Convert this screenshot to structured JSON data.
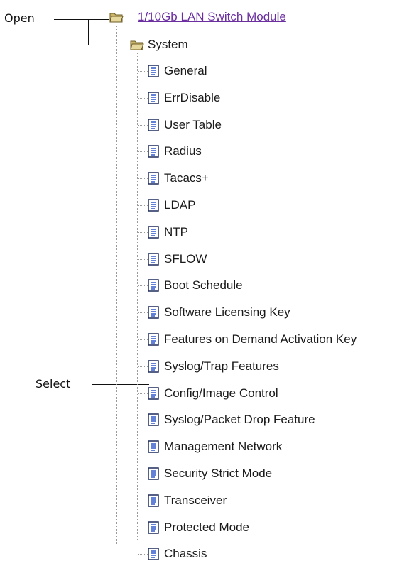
{
  "callouts": {
    "open": "Open",
    "select": "Select"
  },
  "tree": {
    "root": {
      "label": "1/10Gb LAN Switch Module",
      "icon": "folder-open-icon"
    },
    "system": {
      "label": "System",
      "icon": "folder-open-icon"
    },
    "items": [
      {
        "label": "General",
        "icon": "document-icon"
      },
      {
        "label": "ErrDisable",
        "icon": "document-icon"
      },
      {
        "label": "User Table",
        "icon": "document-icon"
      },
      {
        "label": "Radius",
        "icon": "document-icon"
      },
      {
        "label": "Tacacs+",
        "icon": "document-icon"
      },
      {
        "label": "LDAP",
        "icon": "document-icon"
      },
      {
        "label": "NTP",
        "icon": "document-icon"
      },
      {
        "label": "SFLOW",
        "icon": "document-icon"
      },
      {
        "label": "Boot Schedule",
        "icon": "document-icon"
      },
      {
        "label": "Software Licensing Key",
        "icon": "document-icon"
      },
      {
        "label": "Features on Demand Activation Key",
        "icon": "document-icon"
      },
      {
        "label": "Syslog/Trap Features",
        "icon": "document-icon"
      },
      {
        "label": "Config/Image Control",
        "icon": "document-icon"
      },
      {
        "label": "Syslog/Packet Drop Feature",
        "icon": "document-icon"
      },
      {
        "label": "Management Network",
        "icon": "document-icon"
      },
      {
        "label": "Security Strict Mode",
        "icon": "document-icon"
      },
      {
        "label": "Transceiver",
        "icon": "document-icon"
      },
      {
        "label": "Protected Mode",
        "icon": "document-icon"
      },
      {
        "label": "Chassis",
        "icon": "document-icon"
      }
    ]
  }
}
